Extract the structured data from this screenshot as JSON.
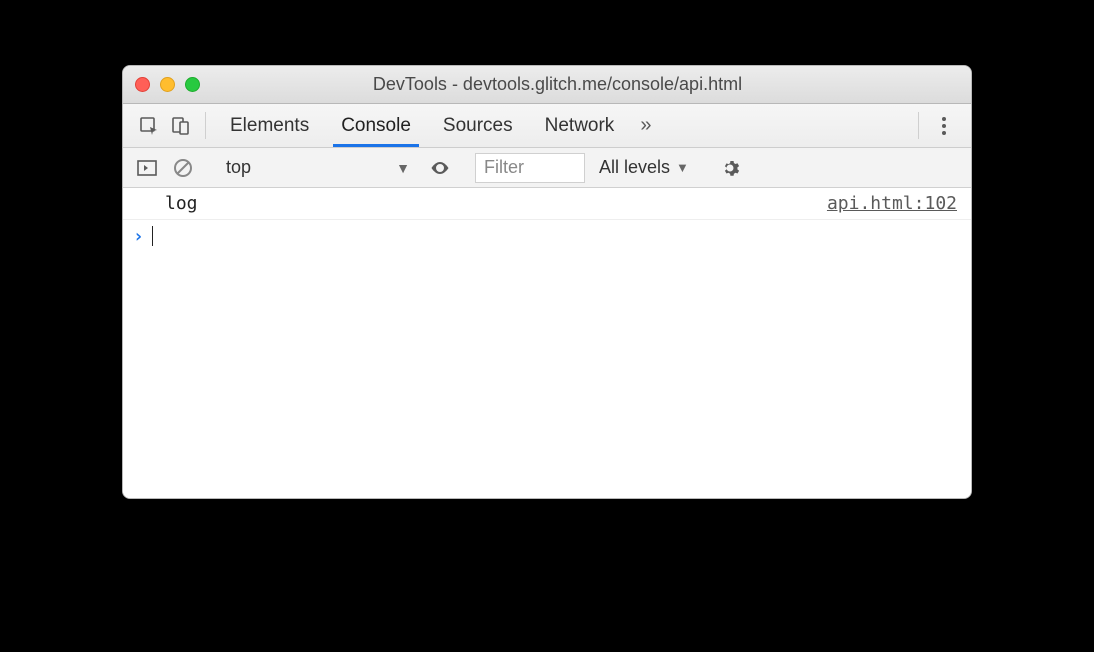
{
  "window": {
    "title": "DevTools - devtools.glitch.me/console/api.html"
  },
  "tabs": {
    "items": [
      "Elements",
      "Console",
      "Sources",
      "Network"
    ],
    "active": "Console",
    "overflow_glyph": "»"
  },
  "toolbar": {
    "context": "top",
    "filter_placeholder": "Filter",
    "levels_label": "All levels"
  },
  "console": {
    "entries": [
      {
        "message": "log",
        "source": "api.html:102"
      }
    ],
    "prompt_glyph": "›"
  }
}
